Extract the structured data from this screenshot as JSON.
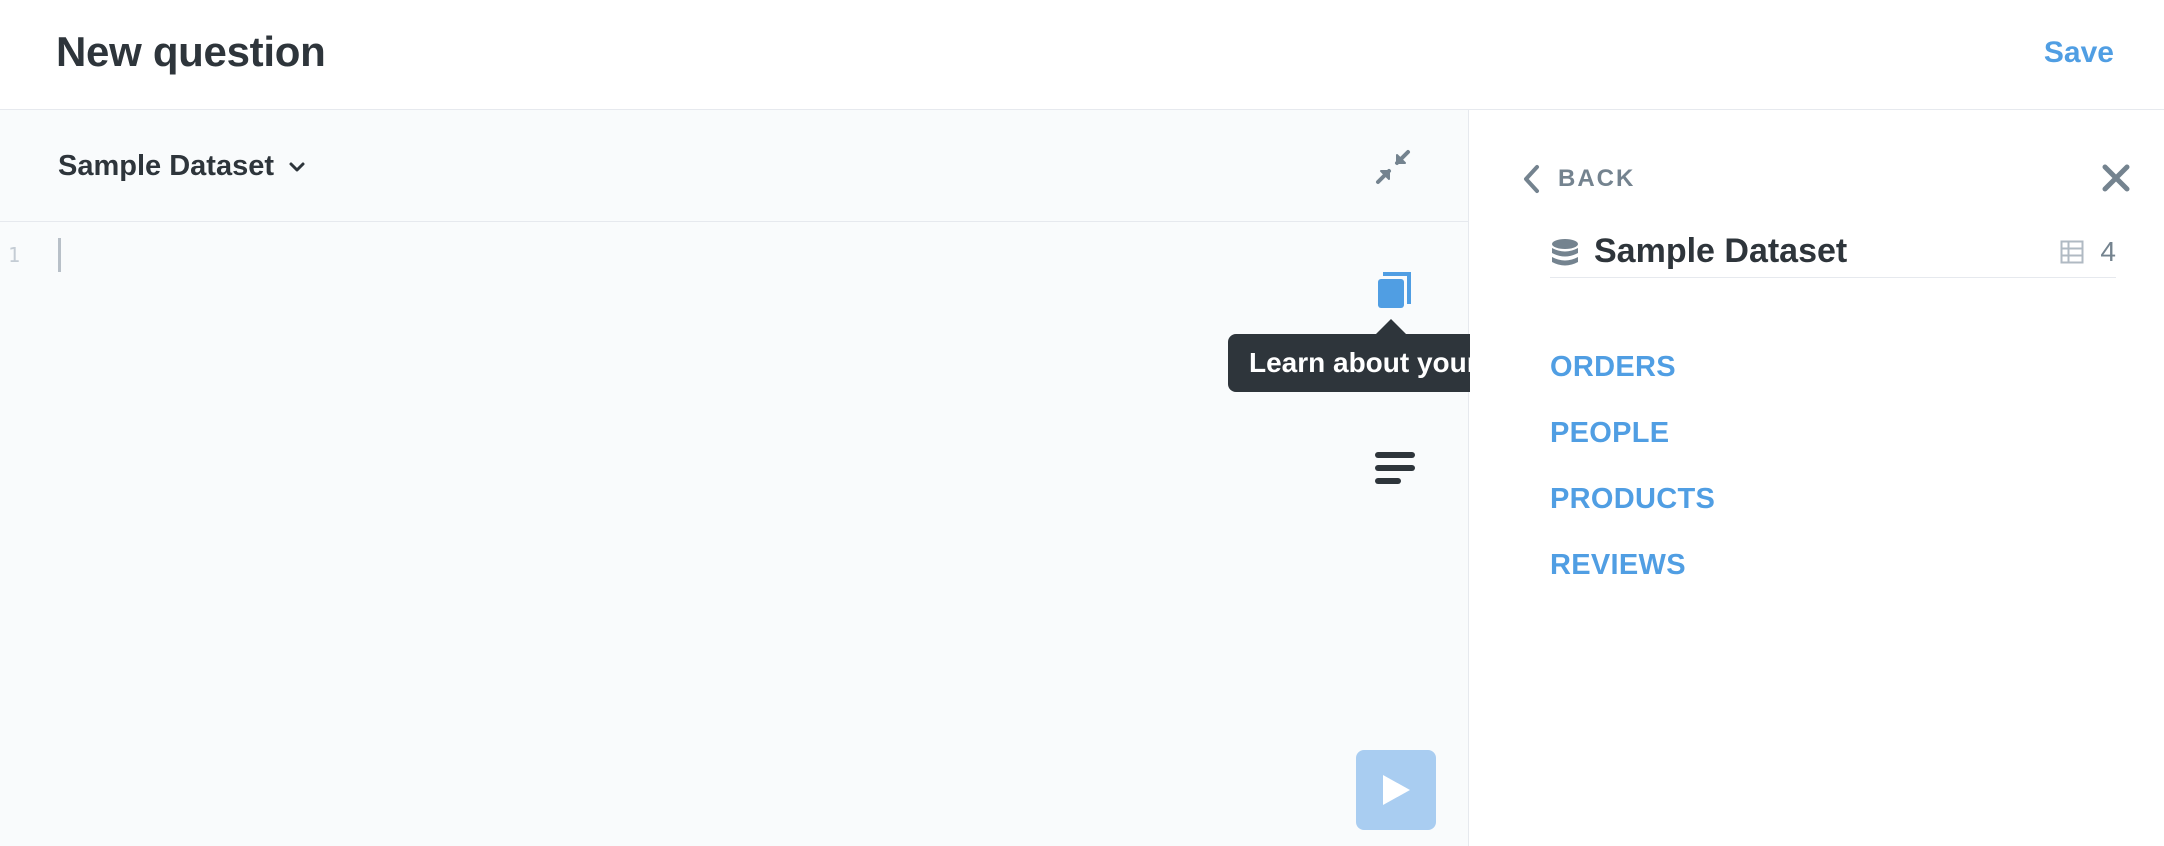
{
  "header": {
    "title": "New question",
    "save_label": "Save"
  },
  "editor": {
    "database_label": "Sample Dataset",
    "line_number": "1",
    "tooltip": "Learn about your data"
  },
  "sidebar": {
    "back_label": "BACK",
    "database_name": "Sample Dataset",
    "table_count": "4",
    "tables": [
      {
        "label": "ORDERS"
      },
      {
        "label": "PEOPLE"
      },
      {
        "label": "PRODUCTS"
      },
      {
        "label": "REVIEWS"
      }
    ]
  },
  "colors": {
    "accent": "#509ee3",
    "text_dark": "#2e353b",
    "text_muted": "#74838f",
    "run_button_disabled": "#a9cdf1",
    "editor_background": "#f9fbfc"
  },
  "icons": [
    "chevron-down-icon",
    "collapse-icon",
    "book-icon",
    "snippet-icon",
    "play-icon",
    "chevron-left-icon",
    "close-icon",
    "database-icon",
    "table-icon"
  ]
}
